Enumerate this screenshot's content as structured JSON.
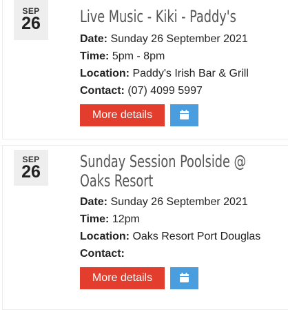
{
  "events": [
    {
      "month": "SEP",
      "day": "26",
      "title_lines": [
        "Live Music - Kiki - Paddy's"
      ],
      "date_label": "Date:",
      "date_value": " Sunday 26 September 2021",
      "time_label": "Time:",
      "time_value": " 5pm - 8pm",
      "location_label": "Location:",
      "location_value": " Paddy's Irish Bar & Grill",
      "contact_label": "Contact:",
      "contact_value": " (07) 4099 5997",
      "details_button": "More details",
      "calendar_icon": "calendar-icon"
    },
    {
      "month": "SEP",
      "day": "26",
      "title_lines": [
        "Sunday Session Poolside @",
        "Oaks Resort"
      ],
      "date_label": "Date:",
      "date_value": " Sunday 26 September 2021",
      "time_label": "Time:",
      "time_value": " 12pm",
      "location_label": "Location:",
      "location_value": " Oaks Resort Port Douglas",
      "contact_label": "Contact:",
      "contact_value": "",
      "details_button": "More details",
      "calendar_icon": "calendar-icon"
    }
  ],
  "colors": {
    "details_button": "#e23d2d",
    "calendar_button": "#4a9edd",
    "date_badge": "#eeeeee",
    "title": "#555555"
  }
}
